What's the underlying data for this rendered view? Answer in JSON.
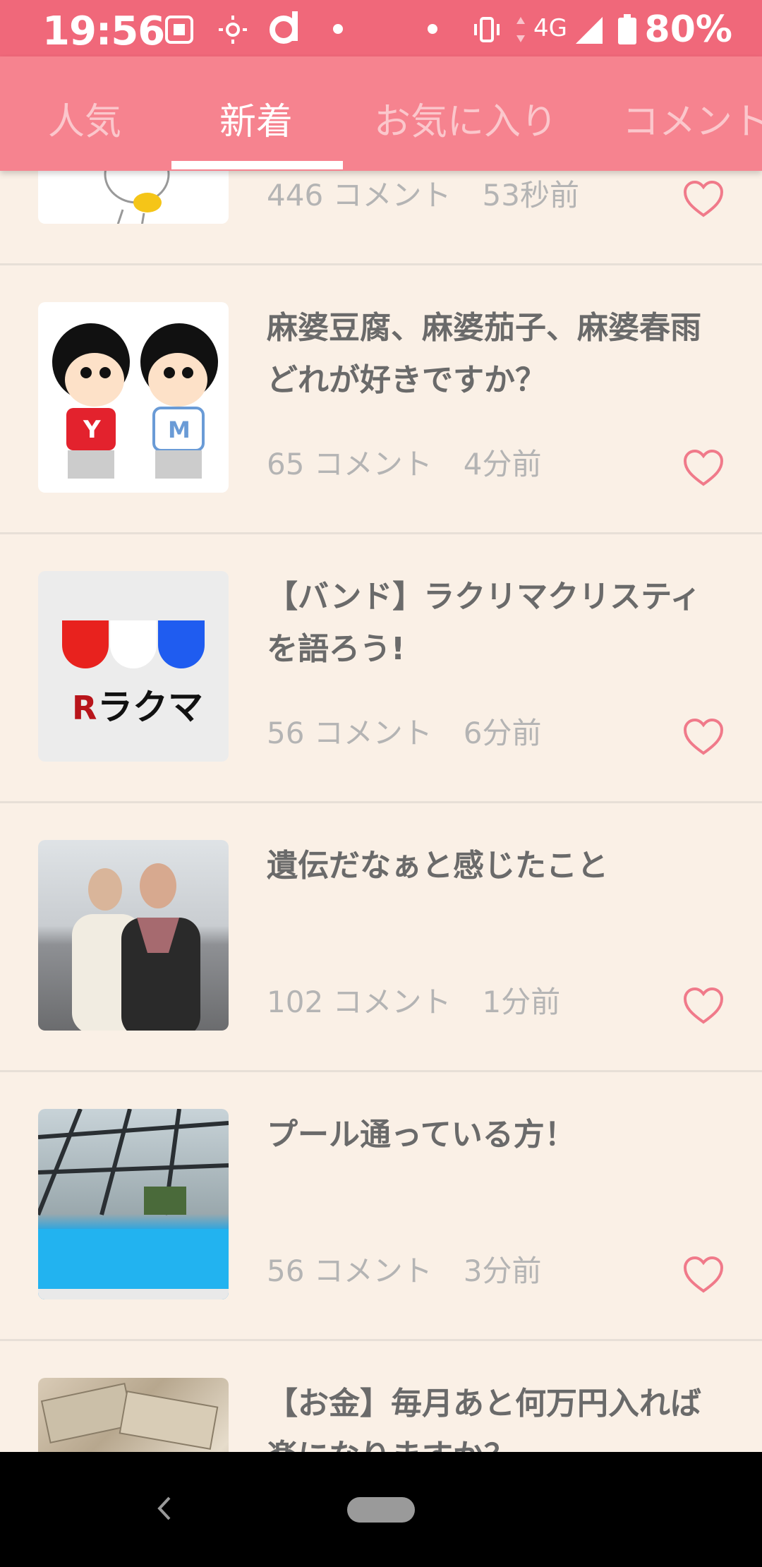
{
  "status_bar": {
    "time": "19:56",
    "network": "4G",
    "battery": "80%"
  },
  "tabs": [
    {
      "label": "人気",
      "active": false
    },
    {
      "label": "新着",
      "active": true
    },
    {
      "label": "お気に入り",
      "active": false
    },
    {
      "label": "コメント",
      "active": false
    }
  ],
  "items": [
    {
      "title": "",
      "comments": "446 コメント",
      "time": "53秒前",
      "thumb": "duck-illustration"
    },
    {
      "title": "麻婆豆腐、麻婆茄子、麻婆春雨どれが好きですか？",
      "comments": "65 コメント",
      "time": "4分前",
      "thumb": "cartoon-kids"
    },
    {
      "title": "【バンド】ラクリマクリスティを語ろう!",
      "comments": "56 コメント",
      "time": "6分前",
      "thumb": "rakuma-logo",
      "thumb_text": "ラクマ"
    },
    {
      "title": "遺伝だなぁと感じたこと",
      "comments": "102 コメント",
      "time": "1分前",
      "thumb": "people-photo"
    },
    {
      "title": "プール通っている方！",
      "comments": "56 コメント",
      "time": "3分前",
      "thumb": "pool-photo"
    },
    {
      "title": "【お金】毎月あと何万円入れば楽になりますか？",
      "comments": "",
      "time": "",
      "thumb": "money-photo"
    }
  ],
  "colors": {
    "status_bar": "#f0687a",
    "tab_bar": "#f6838f",
    "background": "#faf0e6",
    "heart": "#f07a8a"
  }
}
